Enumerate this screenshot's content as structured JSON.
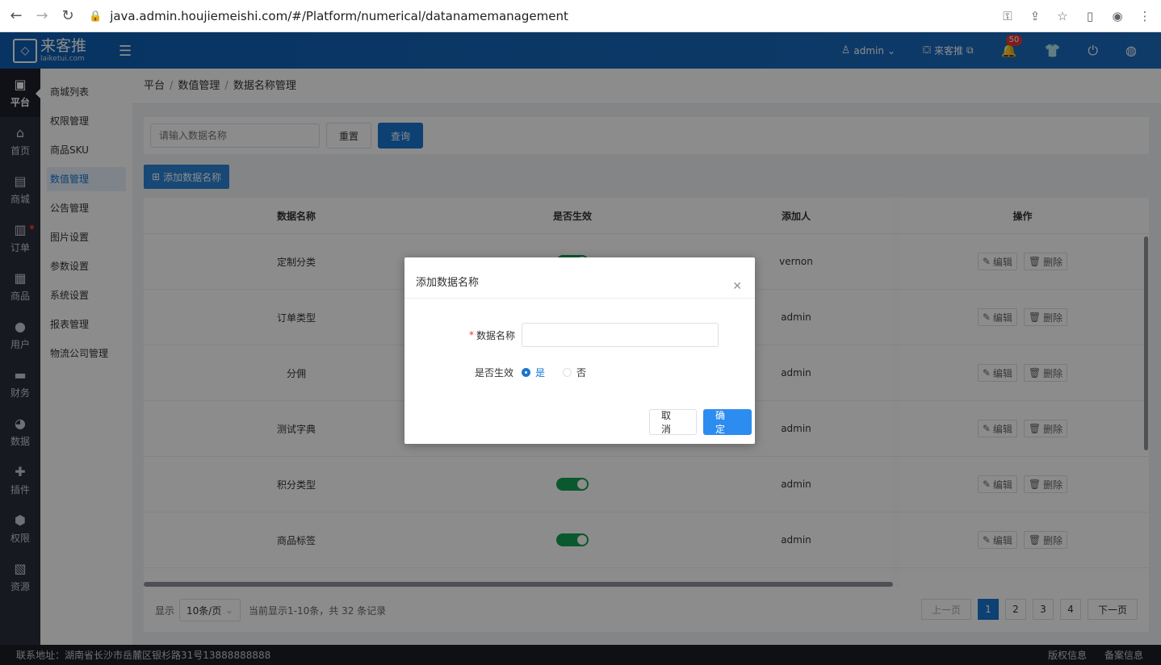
{
  "browser": {
    "url": "java.admin.houjiemeishi.com/#/Platform/numerical/datanamemanagement"
  },
  "header": {
    "logo_cn": "来客推",
    "logo_en": "laiketui.com",
    "user": "admin",
    "store": "来客推",
    "notify_count": "50"
  },
  "icon_sidebar": [
    {
      "label": "平台",
      "icon": "platform-icon",
      "glyph": "▣",
      "active": true
    },
    {
      "label": "首页",
      "icon": "home-icon",
      "glyph": "⌂"
    },
    {
      "label": "商城",
      "icon": "mall-icon",
      "glyph": "▤"
    },
    {
      "label": "订单",
      "icon": "order-icon",
      "glyph": "▥"
    },
    {
      "label": "商品",
      "icon": "goods-icon",
      "glyph": "▦"
    },
    {
      "label": "用户",
      "icon": "user-icon",
      "glyph": "●"
    },
    {
      "label": "财务",
      "icon": "wallet-icon",
      "glyph": "▬"
    },
    {
      "label": "数据",
      "icon": "pie-chart-icon",
      "glyph": "◕"
    },
    {
      "label": "插件",
      "icon": "puzzle-icon",
      "glyph": "✚"
    },
    {
      "label": "权限",
      "icon": "shield-icon",
      "glyph": "⬢"
    },
    {
      "label": "资源",
      "icon": "image-icon",
      "glyph": "▧"
    }
  ],
  "sub_menu": [
    {
      "label": "商城列表"
    },
    {
      "label": "权限管理"
    },
    {
      "label": "商品SKU"
    },
    {
      "label": "数值管理",
      "active": true
    },
    {
      "label": "公告管理"
    },
    {
      "label": "图片设置"
    },
    {
      "label": "参数设置"
    },
    {
      "label": "系统设置"
    },
    {
      "label": "报表管理"
    },
    {
      "label": "物流公司管理"
    }
  ],
  "breadcrumb": [
    "平台",
    "数值管理",
    "数据名称管理"
  ],
  "search": {
    "placeholder": "请输入数据名称",
    "reset_label": "重置",
    "query_label": "查询"
  },
  "add_button_label": "添加数据名称",
  "table": {
    "headers": [
      "数据名称",
      "是否生效",
      "添加人",
      "操作"
    ],
    "rows": [
      {
        "name": "定制分类",
        "enabled": true,
        "creator": "vernon"
      },
      {
        "name": "订单类型",
        "enabled": true,
        "creator": "admin"
      },
      {
        "name": "分佣",
        "enabled": true,
        "creator": "admin"
      },
      {
        "name": "测试字典",
        "enabled": true,
        "creator": "admin"
      },
      {
        "name": "积分类型",
        "enabled": true,
        "creator": "admin"
      },
      {
        "name": "商品标签",
        "enabled": true,
        "creator": "admin"
      }
    ],
    "edit_label": "编辑",
    "delete_label": "删除"
  },
  "pager": {
    "show_label": "显示",
    "page_size": "10条/页",
    "summary": "当前显示1-10条，共 32 条记录",
    "prev_label": "上一页",
    "next_label": "下一页",
    "pages": [
      "1",
      "2",
      "3",
      "4"
    ],
    "current": "1"
  },
  "footer": {
    "address": "联系地址：湖南省长沙市岳麓区银杉路31号13888888888",
    "copyright": "版权信息",
    "icp": "备案信息"
  },
  "dialog": {
    "title": "添加数据名称",
    "name_label": "数据名称",
    "name_value": "",
    "enable_label": "是否生效",
    "yes_label": "是",
    "no_label": "否",
    "selected": "yes",
    "cancel_label": "取消",
    "confirm_label": "确定"
  },
  "colors": {
    "header_blue": "#1c6cc0",
    "primary": "#1976d2",
    "toggle_on": "#13a052",
    "sidebar_dark": "#2a2f3b"
  }
}
